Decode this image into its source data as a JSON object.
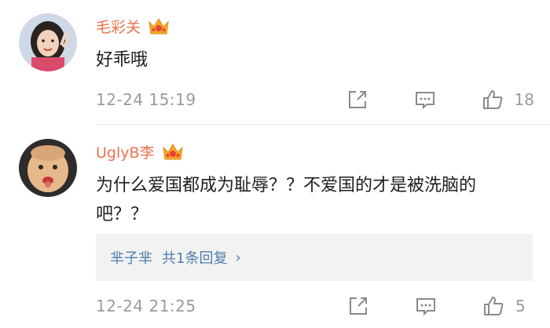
{
  "comments": [
    {
      "username": "毛彩关",
      "text": "好乖哦",
      "timestamp": "12-24 15:19",
      "likes": "18",
      "icons": [
        "avatar",
        "vip-crown-icon",
        "share-icon",
        "comment-icon",
        "like-icon"
      ]
    },
    {
      "username": "UglyB李",
      "text": "为什么爱国都成为耻辱？？不爱国的才是被洗脑的吧？？",
      "timestamp": "12-24 21:25",
      "likes": "5",
      "reply": {
        "user": "芈子芈",
        "count_label": "共1条回复",
        "chevron": "›"
      }
    }
  ],
  "colors": {
    "username": "#eb7350",
    "link": "#507daf",
    "meta": "#9a9a9a",
    "reply_bg": "#f2f2f2",
    "crown": "#f5a623"
  }
}
